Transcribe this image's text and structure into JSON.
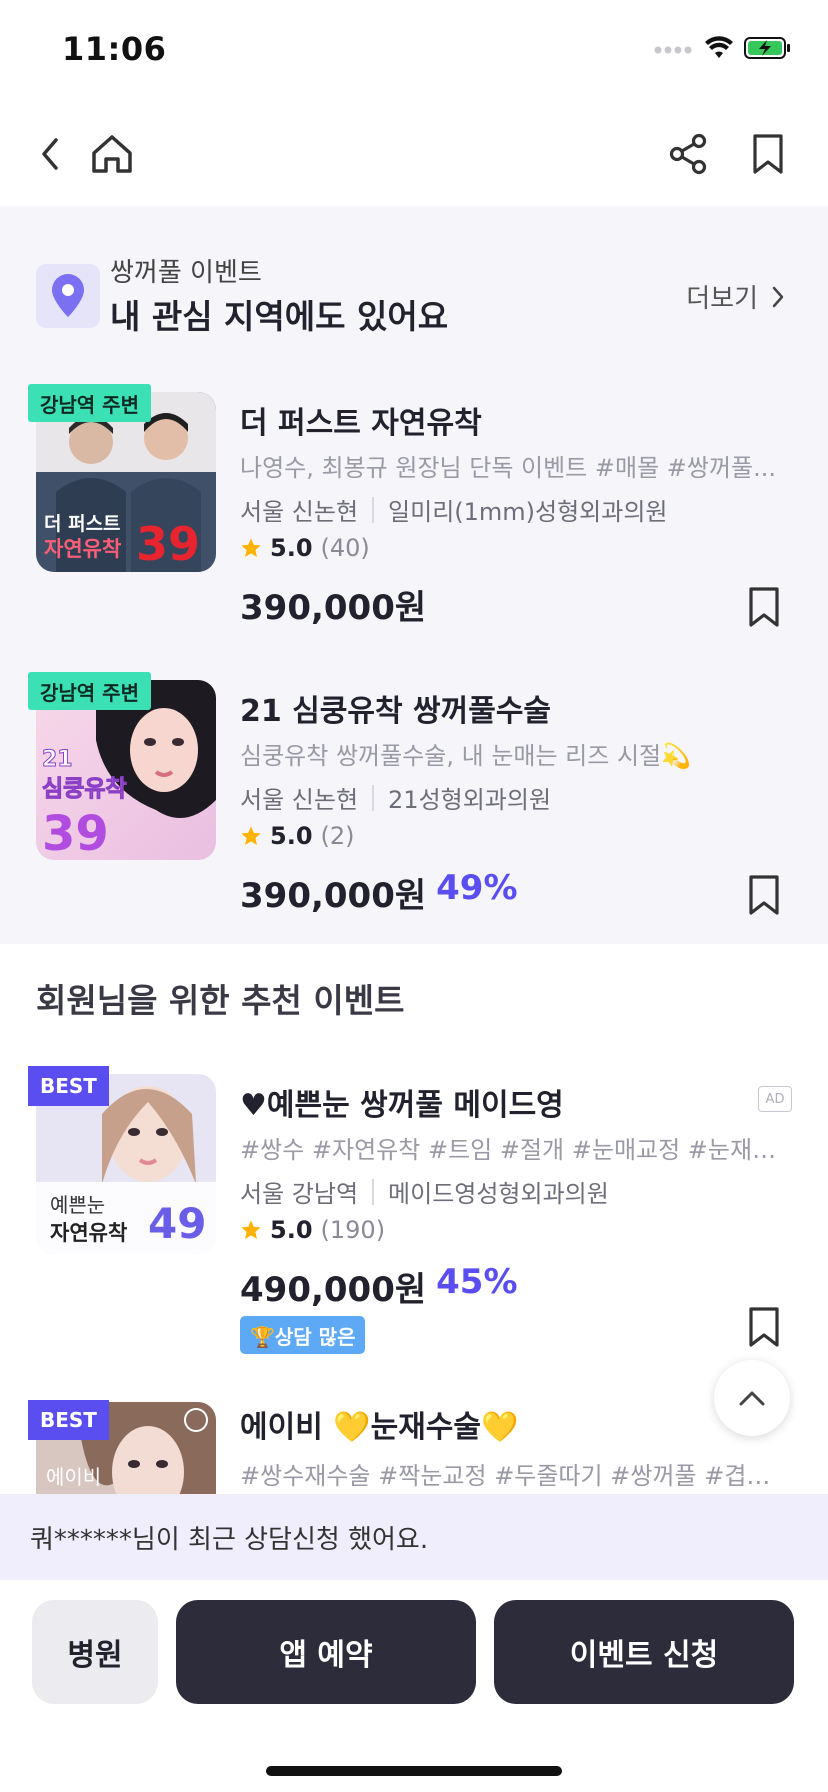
{
  "status_bar": {
    "time": "11:06"
  },
  "region": {
    "subtitle": "쌍꺼풀 이벤트",
    "title": "내 관심 지역에도 있어요",
    "more": "더보기"
  },
  "region_items": [
    {
      "tag": "강남역 주변",
      "title": "더 퍼스트 자연유착",
      "desc": "나영수, 최봉규 원장님 단독 이벤트 #매몰 #쌍꺼풀...",
      "area": "서울 신논현",
      "clinic": "일미리(1mm)성형외과의원",
      "score": "5.0",
      "count": "(40)",
      "price": "390,000원",
      "discount": "",
      "thumb_line1": "더 퍼스트",
      "thumb_line2": "자연유착",
      "thumb_num": "39"
    },
    {
      "tag": "강남역 주변",
      "title": "21 심쿵유착 쌍꺼풀수술",
      "desc": "심쿵유착 쌍꺼풀수술, 내 눈매는 리즈 시절💫",
      "area": "서울 신논현",
      "clinic": "21성형외과의원",
      "score": "5.0",
      "count": "(2)",
      "price": "390,000원",
      "discount": "49%",
      "thumb_line1": "21",
      "thumb_line2": "심쿵유착",
      "thumb_num": "39"
    }
  ],
  "recommend": {
    "title": "회원님을 위한 추천 이벤트"
  },
  "rec_items": [
    {
      "tag": "BEST",
      "title": "♥예쁜눈 쌍꺼풀 메이드영",
      "desc": "#쌍수 #자연유착 #트임 #절개 #눈매교정 #눈재수...",
      "area": "서울 강남역",
      "clinic": "메이드영성형외과의원",
      "score": "5.0",
      "count": "(190)",
      "price": "490,000원",
      "discount": "45%",
      "badge": "🏆상담 많은",
      "ad": "AD",
      "thumb_line1": "예쁜눈",
      "thumb_line2": "자연유착",
      "thumb_num": "49"
    },
    {
      "tag": "BEST",
      "title": "에이비 💛눈재수술💛",
      "desc": "#쌍수재수술 #짝눈교정 #두줄따기 #쌍꺼풀 #겹쌍...",
      "thumb_line1": "에이비"
    }
  ],
  "notice": "쿼******님이 최근 상담신청 했어요.",
  "bottom_bar": {
    "hospital": "병원",
    "app_booking": "앱 예약",
    "event_apply": "이벤트 신청"
  },
  "colors": {
    "accent": "#5b4ef0",
    "tag_green": "#3be0b4",
    "dark_button": "#2c2c3a",
    "section_bg": "#f5f5fa"
  }
}
